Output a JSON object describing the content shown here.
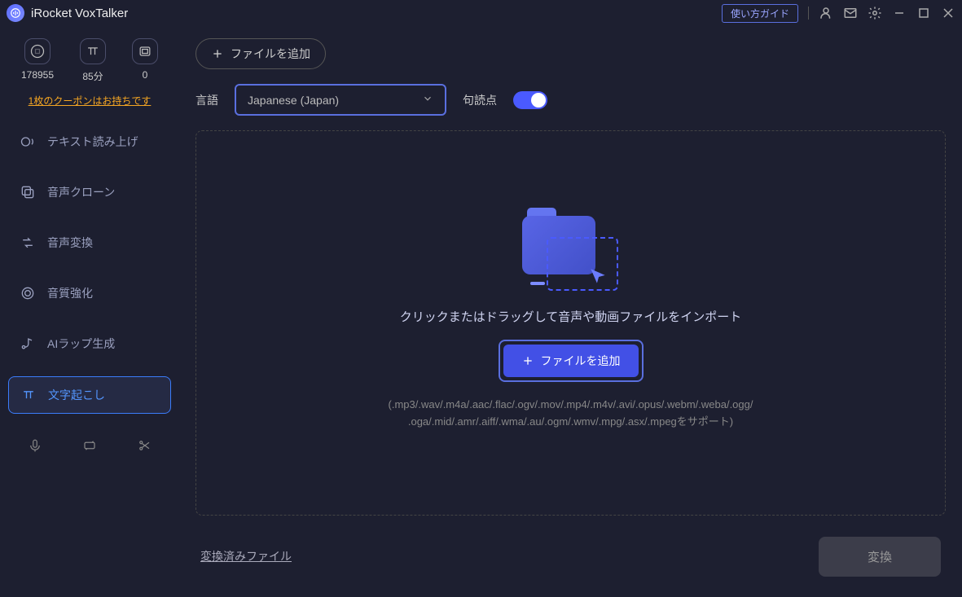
{
  "app": {
    "title": "iRocket VoxTalker"
  },
  "titlebar": {
    "guide_label": "使い方ガイド"
  },
  "stats": {
    "chars": {
      "value": "178955"
    },
    "minutes": {
      "value": "85分"
    },
    "items": {
      "value": "0"
    }
  },
  "coupon": {
    "text": "1枚のクーポンはお持ちです"
  },
  "nav": {
    "tts": "テキスト読み上げ",
    "clone": "音声クローン",
    "convert": "音声変換",
    "enhance": "音質強化",
    "rap": "AIラップ生成",
    "transcribe": "文字起こし"
  },
  "toolbar": {
    "add_label": "ファイルを追加",
    "language_label": "言語",
    "language_value": "Japanese (Japan)",
    "punctuation_label": "句読点"
  },
  "dropzone": {
    "title": "クリックまたはドラッグして音声や動画ファイルをインポート",
    "button_label": "ファイルを追加",
    "formats_1": "(.mp3/.wav/.m4a/.aac/.flac/.ogv/.mov/.mp4/.m4v/.avi/.opus/.webm/.weba/.ogg/",
    "formats_2": ".oga/.mid/.amr/.aiff/.wma/.au/.ogm/.wmv/.mpg/.asx/.mpegをサポート)"
  },
  "footer": {
    "converted": "変換済みファイル",
    "convert": "変換"
  }
}
